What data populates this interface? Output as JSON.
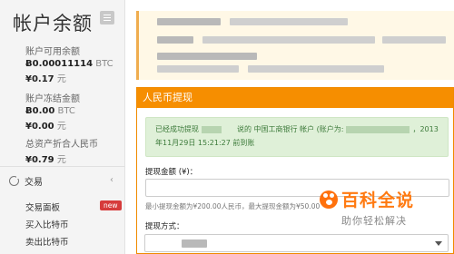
{
  "sidebar": {
    "title": "帐户余额",
    "menu_icon": "hamburger-icon",
    "available": {
      "label": "账户可用余额",
      "btc_amount": "Ƀ0.00011114",
      "btc_unit": "BTC",
      "cny": "¥0.17",
      "cny_unit": "元"
    },
    "frozen": {
      "label": "账户冻结金额",
      "btc_amount": "Ƀ0.00",
      "btc_unit": "BTC",
      "cny": "¥0.00",
      "cny_unit": "元"
    },
    "total": {
      "label": "总资产折合人民币",
      "cny": "¥0.79",
      "cny_unit": "元"
    },
    "section": {
      "label": "交易",
      "icon": "refresh-icon"
    },
    "items": [
      {
        "label": "交易面板",
        "badge": "new"
      },
      {
        "label": "买入比特币"
      },
      {
        "label": "卖出比特币"
      }
    ]
  },
  "panel": {
    "title": "人民币提现",
    "alert": {
      "line1_prefix": "已经成功提现",
      "line1_mid": "说的 中国工商银行 帐户 (账户为:",
      "line1_suffix": "，2013",
      "line2": "年11月29日 15:21:27 前到账"
    },
    "amount_label": "提现金额 (¥)：",
    "amount_help": "最小提现金额为¥200.00人民币，最大提现金额为¥50.00",
    "method_label": "提现方式："
  },
  "watermark": {
    "brand": "百科全说",
    "tagline": "助你轻松解决"
  },
  "colors": {
    "accent": "#f68e00",
    "success_bg": "#dff0d8",
    "success_text": "#3c7a3a",
    "badge": "#d63b3b"
  }
}
